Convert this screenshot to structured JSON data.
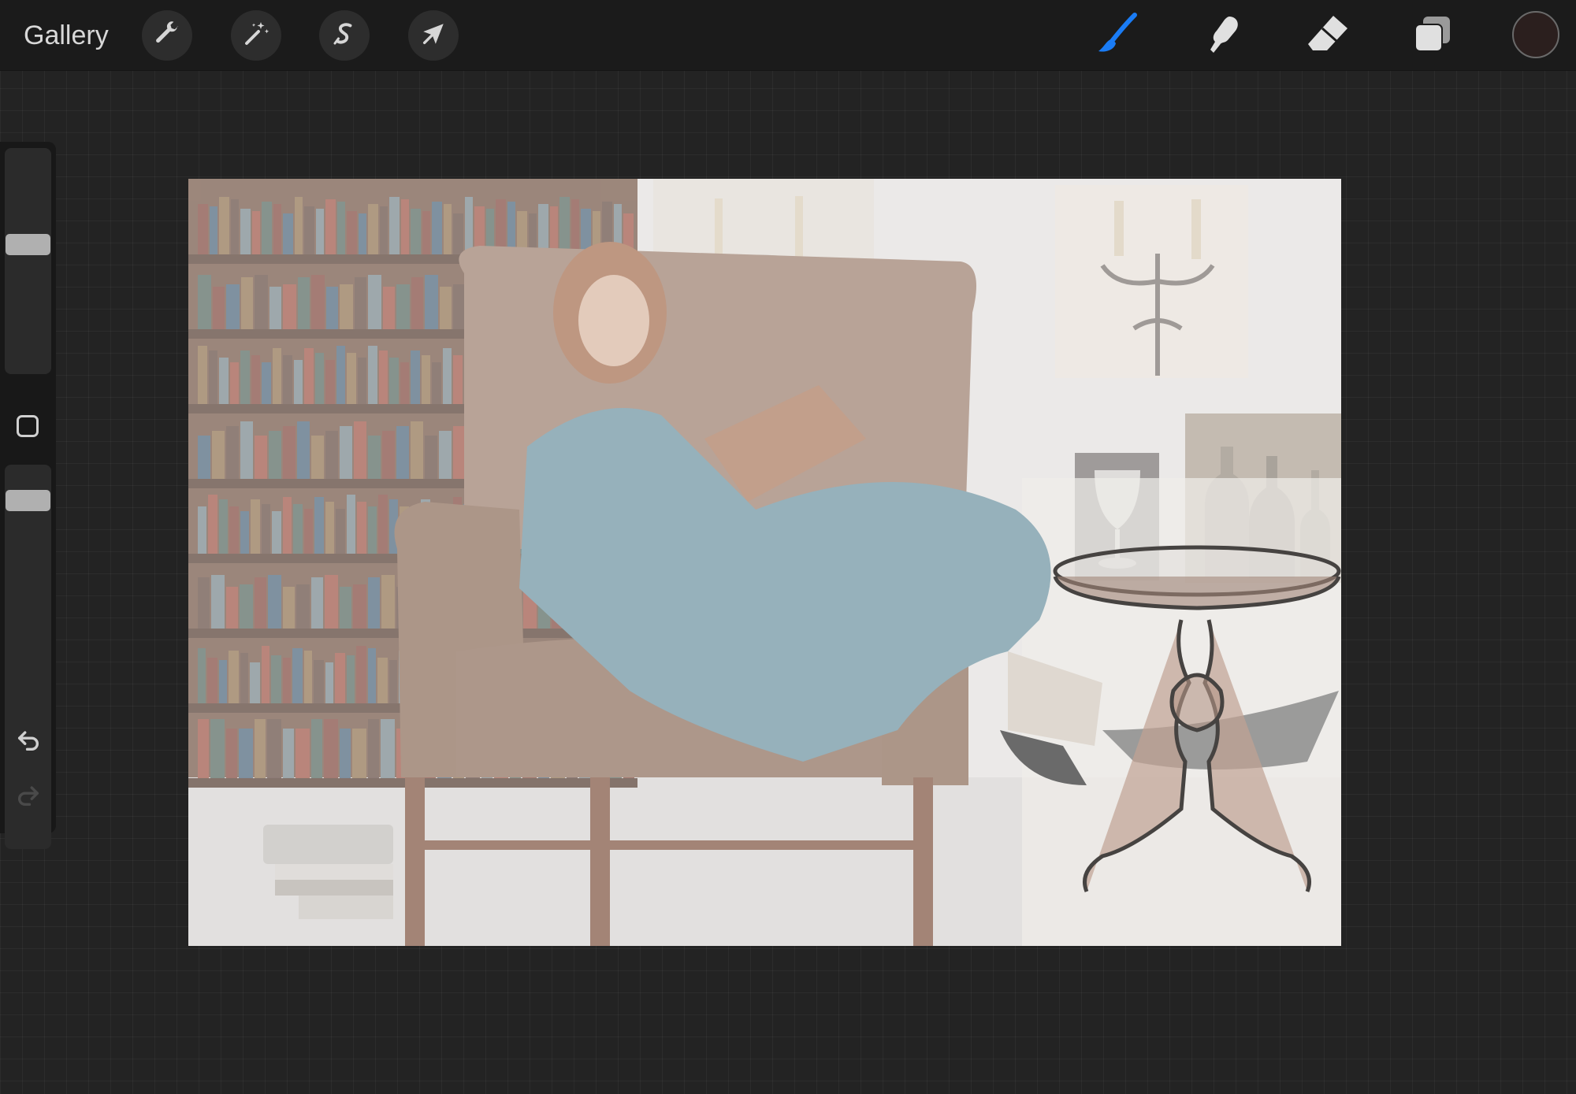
{
  "toolbar": {
    "gallery_label": "Gallery",
    "left_tools": [
      {
        "name": "actions",
        "icon": "wrench-icon"
      },
      {
        "name": "adjustments",
        "icon": "magic-wand-icon"
      },
      {
        "name": "selection",
        "icon": "selection-s-icon"
      },
      {
        "name": "transform",
        "icon": "arrow-cursor-icon"
      }
    ],
    "right_tools": [
      {
        "name": "brush",
        "icon": "brush-icon",
        "active": true
      },
      {
        "name": "smudge",
        "icon": "smudge-icon",
        "active": false
      },
      {
        "name": "eraser",
        "icon": "eraser-icon",
        "active": false
      },
      {
        "name": "layers",
        "icon": "layers-icon",
        "active": false
      }
    ],
    "current_color": "#2b1f1e",
    "active_tool_color": "#1a7cf5"
  },
  "sidebar": {
    "brush_size_level": 0.58,
    "opacity_level": 0.93,
    "modify_button_icon": "square-icon",
    "undo_icon": "undo-icon",
    "redo_icon": "redo-icon",
    "redo_enabled": false
  },
  "canvas": {
    "contents": [
      "bookshelf",
      "wingback-armchair",
      "woman-reading",
      "candelabra-sconce",
      "wine-glass",
      "glass-bottles",
      "pedestal-side-table"
    ],
    "background_color": "#e7e5e3"
  }
}
